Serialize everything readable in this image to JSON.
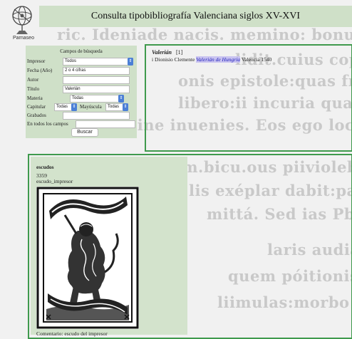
{
  "logo": {
    "label": "Parnaseo",
    "icon": "armillary-sphere-icon"
  },
  "header": {
    "title": "Consulta tipobibliografía Valenciana siglos XV-XVI"
  },
  "search_form": {
    "title": "Campos de búsqueda",
    "fields": {
      "impresor": {
        "label": "Impresor",
        "value": "Todos"
      },
      "fecha": {
        "label": "Fecha (Año)",
        "value": "2 o 4 cifras"
      },
      "autor": {
        "label": "Autor",
        "value": ""
      },
      "titulo": {
        "label": "Título",
        "value": "Valerián"
      },
      "materia": {
        "label": "Materia",
        "value": "Todas"
      },
      "capitular": {
        "label": "Capitular",
        "value": "Todas"
      },
      "mayuscula": {
        "label": "Mayúscula",
        "value": "Todas"
      },
      "grabados": {
        "label": "Grabados",
        "value": ""
      },
      "todos": {
        "label": "En todos los campos",
        "value": ""
      }
    },
    "button_label": "Buscar"
  },
  "results": {
    "term": "Valerián",
    "count": "[1]",
    "entry": {
      "prefix": "i Dionisio Clemente",
      "link": "Valerián de Hungría",
      "suffix": "Valencia 1540"
    }
  },
  "detail": {
    "heading": "escudos",
    "number": "3359",
    "type": "escudo_impresor",
    "comment": "Comentario: escudo del impresor",
    "image": "printer-shield-woodcut"
  },
  "background_text": [
    "ric. Ideniade nacis. memino: bonus pe",
    "lidit.cuius copiam cu etiam",
    "onis epistole:quas frequenter in",
    "libero:ii incuria qua meoo fi",
    "mine inuenies. Eos ego locos annotaui:conatis",
    "rum.bicu.ous piiviolebeco codices. Jacob lauenos",
    "lis exéplar dabit:particulio",
    "mittá. Sed ias Pba",
    "laris audiam?",
    "quem póitionis a",
    "liimulas:morbo me iau"
  ],
  "colors": {
    "panel": "#cfe0c8",
    "border": "#3f9a4d",
    "link_highlight": "#c9c3f0",
    "select_arrow": "#4b7fd6"
  }
}
